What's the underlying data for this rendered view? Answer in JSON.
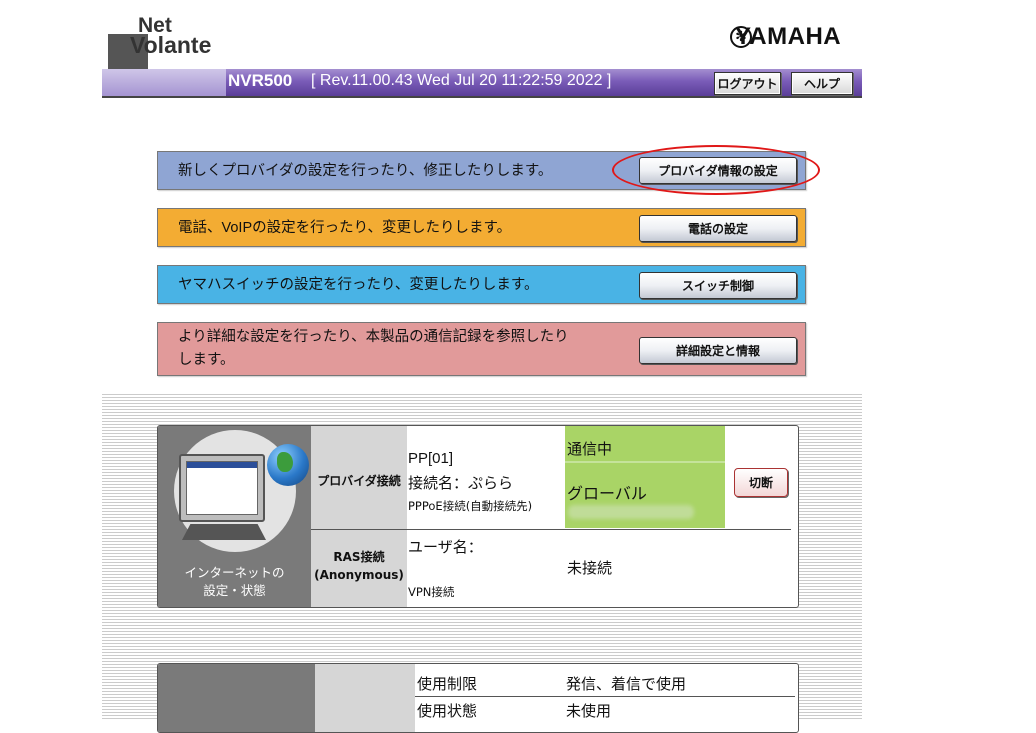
{
  "header": {
    "logo_line1": "Net",
    "logo_line2": "Volante",
    "brand": "YAMAHA",
    "model": "NVR500",
    "revision": "[ Rev.11.00.43 Wed Jul 20 11:22:59 2022 ]",
    "logout_label": "ログアウト",
    "help_label": "ヘルプ"
  },
  "menu": [
    {
      "description": "新しくプロバイダの設定を行ったり、修正したりします。",
      "button": "プロバイダ情報の設定",
      "color": "#8fa5d3"
    },
    {
      "description": "電話、VoIPの設定を行ったり、変更したりします。",
      "button": "電話の設定",
      "color": "#f3ac33"
    },
    {
      "description": "ヤマハスイッチの設定を行ったり、変更したりします。",
      "button": "スイッチ制御",
      "color": "#49b3e5"
    },
    {
      "description_line1": "より詳細な設定を行ったり、本製品の通信記録を参照したり",
      "description_line2": "します。",
      "button": "詳細設定と情報",
      "color": "#e19a9a"
    }
  ],
  "internet": {
    "panel_label_line1": "インターネットの",
    "panel_label_line2": "設定・状態",
    "provider": {
      "type": "プロバイダ接続",
      "id": "PP[01]",
      "connection_name": "接続名：ぷらら",
      "method": "PPPoE接続(自動接続先)",
      "status": "通信中",
      "address_type": "グローバル",
      "disconnect_label": "切断"
    },
    "ras": {
      "type_line1": "RAS接続",
      "type_line2": "(Anonymous)",
      "user_label": "ユーザ名：",
      "vpn_label": "VPN接続",
      "status": "未接続"
    }
  },
  "phone": {
    "rows": [
      {
        "label": "使用制限",
        "value": "発信、着信で使用"
      },
      {
        "label": "使用状態",
        "value": "未使用"
      }
    ]
  }
}
